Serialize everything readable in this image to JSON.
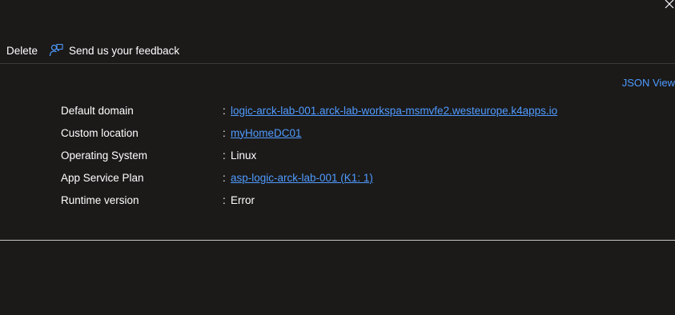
{
  "toolbar": {
    "delete_label": "Delete",
    "feedback_label": "Send us your feedback"
  },
  "json_view_label": "JSON View",
  "properties": [
    {
      "label": "Default domain",
      "value": "logic-arck-lab-001.arck-lab-workspa-msmvfe2.westeurope.k4apps.io",
      "is_link": true
    },
    {
      "label": "Custom location",
      "value": "myHomeDC01",
      "is_link": true
    },
    {
      "label": "Operating System",
      "value": "Linux",
      "is_link": false
    },
    {
      "label": "App Service Plan",
      "value": "asp-logic-arck-lab-001 (K1: 1)",
      "is_link": true
    },
    {
      "label": "Runtime version",
      "value": "Error",
      "is_link": false
    }
  ],
  "separator": ":",
  "colors": {
    "background": "#1b1a19",
    "link": "#4f9bff",
    "text": "#ffffff",
    "divider": "#3b3a39"
  }
}
